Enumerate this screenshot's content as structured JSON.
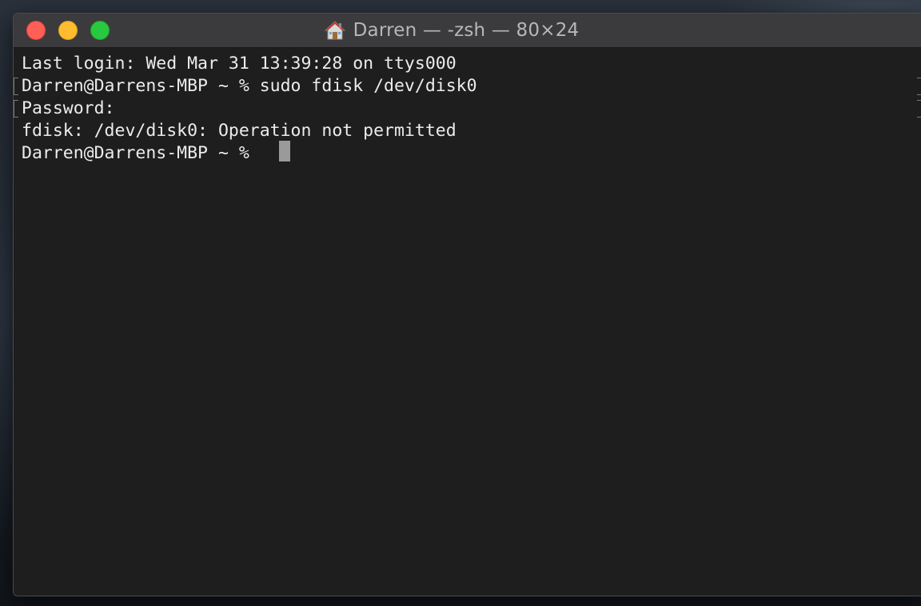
{
  "window": {
    "title": "Darren — -zsh — 80×24",
    "title_icon": "home-folder-icon"
  },
  "controls": {
    "close": "close-button",
    "minimize": "minimize-button",
    "zoom": "zoom-button",
    "colors": {
      "close": "#fe5f57",
      "minimize": "#febc2e",
      "zoom": "#28c840"
    }
  },
  "terminal": {
    "lines": [
      "Last login: Wed Mar 31 13:39:28 on ttys000",
      "Darren@Darrens-MBP ~ % sudo fdisk /dev/disk0",
      "Password:",
      "fdisk: /dev/disk0: Operation not permitted",
      "Darren@Darrens-MBP ~ % "
    ],
    "background": "#1e1e1e",
    "foreground": "#ececec",
    "cursor_color": "#9a9a9a"
  }
}
